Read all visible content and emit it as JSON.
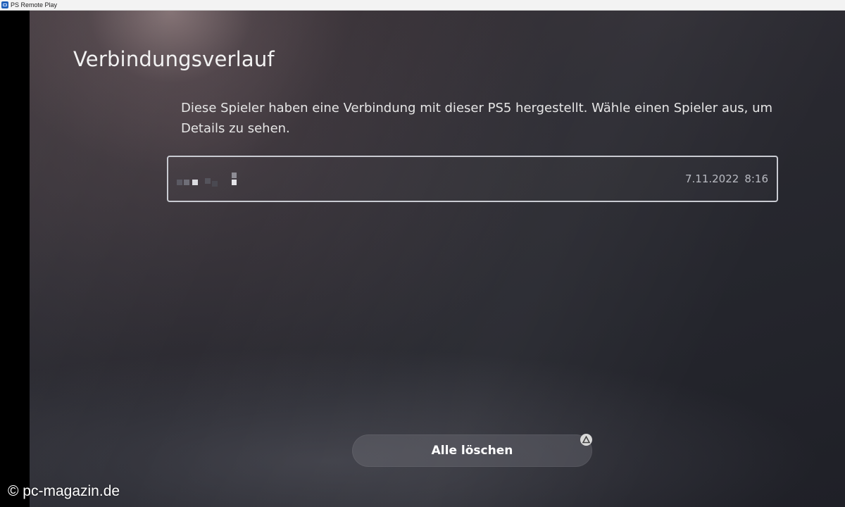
{
  "window": {
    "title": "PS Remote Play"
  },
  "screen": {
    "title": "Verbindungsverlauf",
    "description": "Diese Spieler haben eine Verbindung mit dieser PS5 hergestellt. Wähle einen Spieler aus, um Details zu sehen."
  },
  "history": [
    {
      "player_name_pixelated": true,
      "date": "7.11.2022",
      "time": "8:16"
    }
  ],
  "actions": {
    "clear_all_label": "Alle löschen",
    "clear_all_button_hint_icon": "triangle-button-icon"
  },
  "watermark": "© pc-magazin.de"
}
